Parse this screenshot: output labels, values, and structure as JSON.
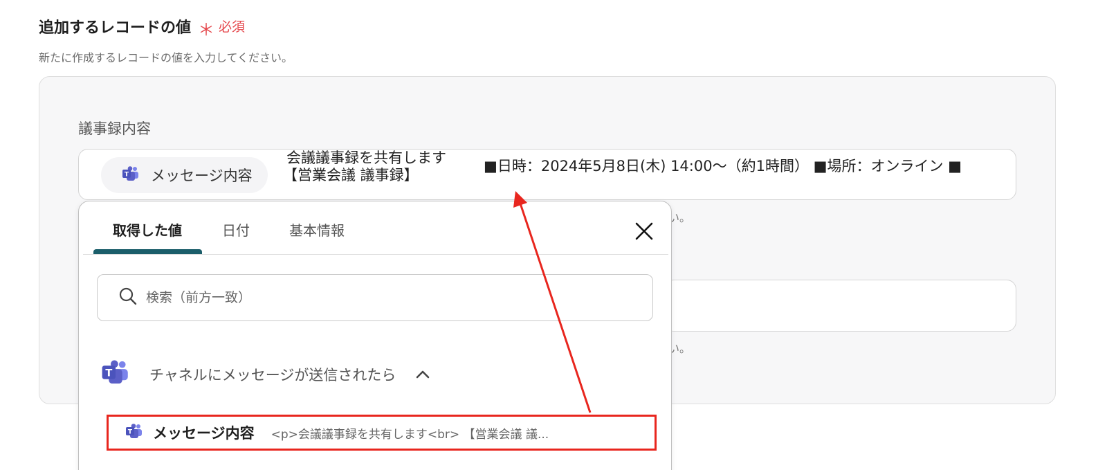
{
  "section": {
    "title": "追加するレコードの値",
    "required_star": "＊",
    "required_label": "必須",
    "description": "新たに作成するレコードの値を入力してください。"
  },
  "field": {
    "label": "議事録内容",
    "chip_label": "メッセージ内容",
    "preview_line1": "会議議事録を共有します",
    "preview_line2": "【営業会議 議事録】",
    "preview_line3": "■日時：2024年5月8日(木) 14:00～（約1時間） ■場所：オンライン ■",
    "hint_fragment": "い。"
  },
  "popup": {
    "tabs": [
      {
        "label": "取得した値"
      },
      {
        "label": "日付"
      },
      {
        "label": "基本情報"
      }
    ],
    "search_placeholder": "検索（前方一致）",
    "group_title": "チャネルにメッセージが送信されたら",
    "result": {
      "title": "メッセージ内容",
      "preview": "<p>会議議事録を共有します<br> 【営業会議 議..."
    }
  },
  "colors": {
    "accent_tab": "#1b5e6a",
    "highlight_red": "#e8261e",
    "required_red": "#e5484d",
    "teams_purple": "#5b5fc7"
  }
}
